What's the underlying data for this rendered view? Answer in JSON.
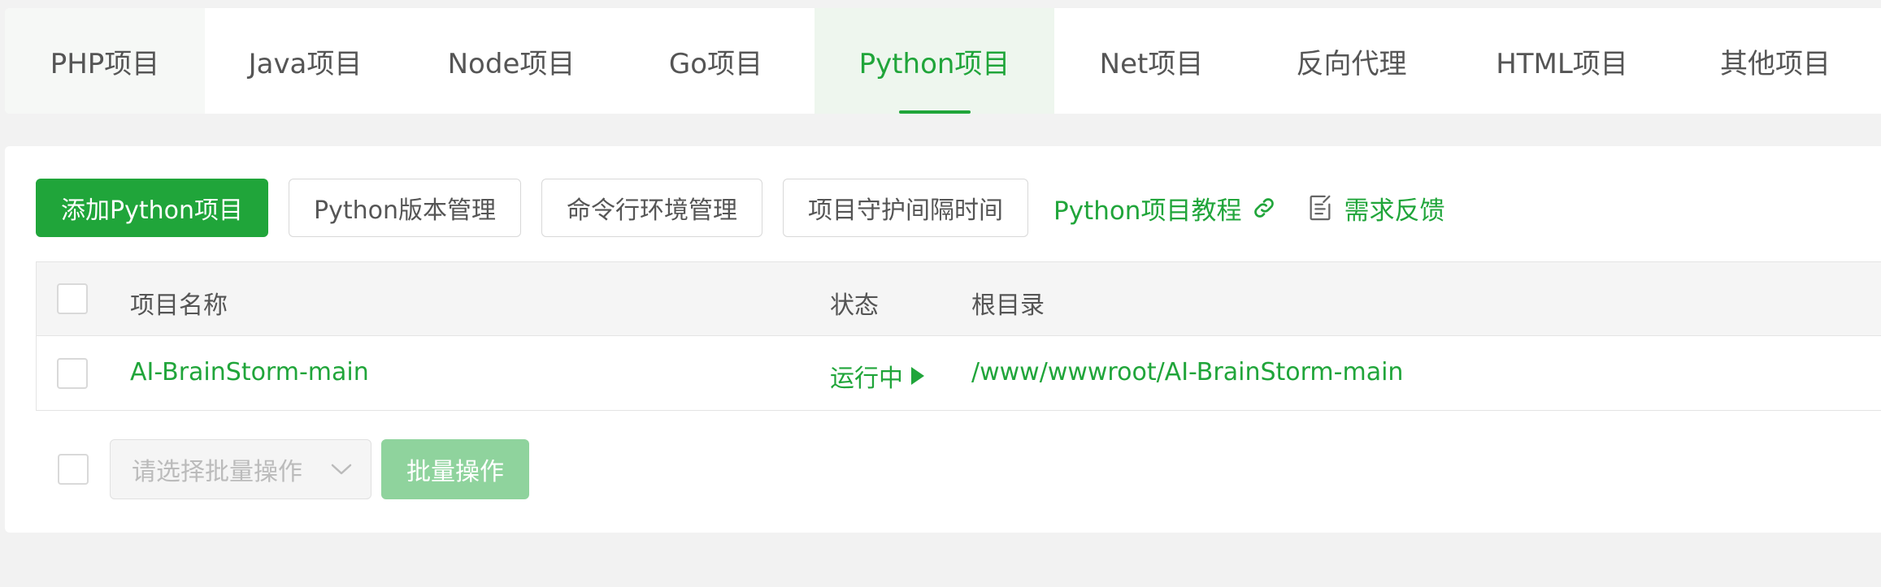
{
  "tabs": [
    {
      "label": "PHP项目",
      "name": "tab-php",
      "width": 246
    },
    {
      "label": "Java项目",
      "name": "tab-java",
      "width": 247
    },
    {
      "label": "Node项目",
      "name": "tab-node",
      "width": 260
    },
    {
      "label": "Go项目",
      "name": "tab-go",
      "width": 243
    },
    {
      "label": "Python项目",
      "name": "tab-python",
      "width": 295
    },
    {
      "label": "Net项目",
      "name": "tab-net",
      "width": 239
    },
    {
      "label": "反向代理",
      "name": "tab-reverse-proxy",
      "width": 253
    },
    {
      "label": "HTML项目",
      "name": "tab-html",
      "width": 265
    },
    {
      "label": "其他项目",
      "name": "tab-other",
      "width": 260
    }
  ],
  "active_tab": "Python项目",
  "toolbar": {
    "add_label": "添加Python项目",
    "version_label": "Python版本管理",
    "cli_label": "命令行环境管理",
    "guard_label": "项目守护间隔时间",
    "tutorial_label": "Python项目教程",
    "feedback_label": "需求反馈"
  },
  "table": {
    "headers": {
      "name": "项目名称",
      "status": "状态",
      "path": "根目录"
    },
    "rows": [
      {
        "name": "AI-BrainStorm-main",
        "status": "运行中",
        "path": "/www/wwwroot/AI-BrainStorm-main"
      }
    ]
  },
  "batch": {
    "select_placeholder": "请选择批量操作",
    "button_label": "批量操作"
  },
  "colors": {
    "accent": "#20a53a",
    "accent_light": "#8fd39d"
  }
}
